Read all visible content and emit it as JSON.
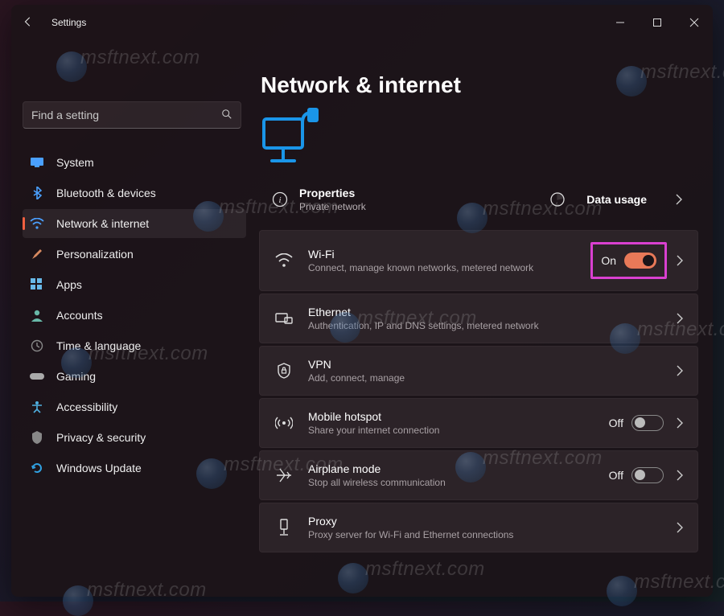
{
  "window": {
    "title": "Settings"
  },
  "search": {
    "placeholder": "Find a setting"
  },
  "sidebar": {
    "items": [
      {
        "label": "System",
        "icon": "system",
        "color": "#4aa0ff"
      },
      {
        "label": "Bluetooth & devices",
        "icon": "bluetooth",
        "color": "#4aa0ff"
      },
      {
        "label": "Network & internet",
        "icon": "wifi",
        "color": "#4aa0ff",
        "active": true
      },
      {
        "label": "Personalization",
        "icon": "brush",
        "color": "#d88a60"
      },
      {
        "label": "Apps",
        "icon": "apps",
        "color": "#68b8e8"
      },
      {
        "label": "Accounts",
        "icon": "account",
        "color": "#68b8a8"
      },
      {
        "label": "Time & language",
        "icon": "time",
        "color": "#888"
      },
      {
        "label": "Gaming",
        "icon": "gaming",
        "color": "#aaa"
      },
      {
        "label": "Accessibility",
        "icon": "accessibility",
        "color": "#50b0e0"
      },
      {
        "label": "Privacy & security",
        "icon": "privacy",
        "color": "#888"
      },
      {
        "label": "Windows Update",
        "icon": "update",
        "color": "#30a0e0"
      }
    ]
  },
  "page": {
    "title": "Network & internet",
    "info": {
      "properties_label": "Properties",
      "properties_sub": "Private network",
      "data_usage_label": "Data usage"
    },
    "cards": [
      {
        "key": "wifi",
        "title": "Wi-Fi",
        "subtitle": "Connect, manage known networks, metered network",
        "toggle": true,
        "state": "On",
        "on": true,
        "highlight": true
      },
      {
        "key": "ethernet",
        "title": "Ethernet",
        "subtitle": "Authentication, IP and DNS settings, metered network"
      },
      {
        "key": "vpn",
        "title": "VPN",
        "subtitle": "Add, connect, manage"
      },
      {
        "key": "hotspot",
        "title": "Mobile hotspot",
        "subtitle": "Share your internet connection",
        "toggle": true,
        "state": "Off",
        "on": false
      },
      {
        "key": "airplane",
        "title": "Airplane mode",
        "subtitle": "Stop all wireless communication",
        "toggle": true,
        "state": "Off",
        "on": false
      },
      {
        "key": "proxy",
        "title": "Proxy",
        "subtitle": "Proxy server for Wi-Fi and Ethernet connections"
      }
    ]
  },
  "watermark": "msftnext.com"
}
